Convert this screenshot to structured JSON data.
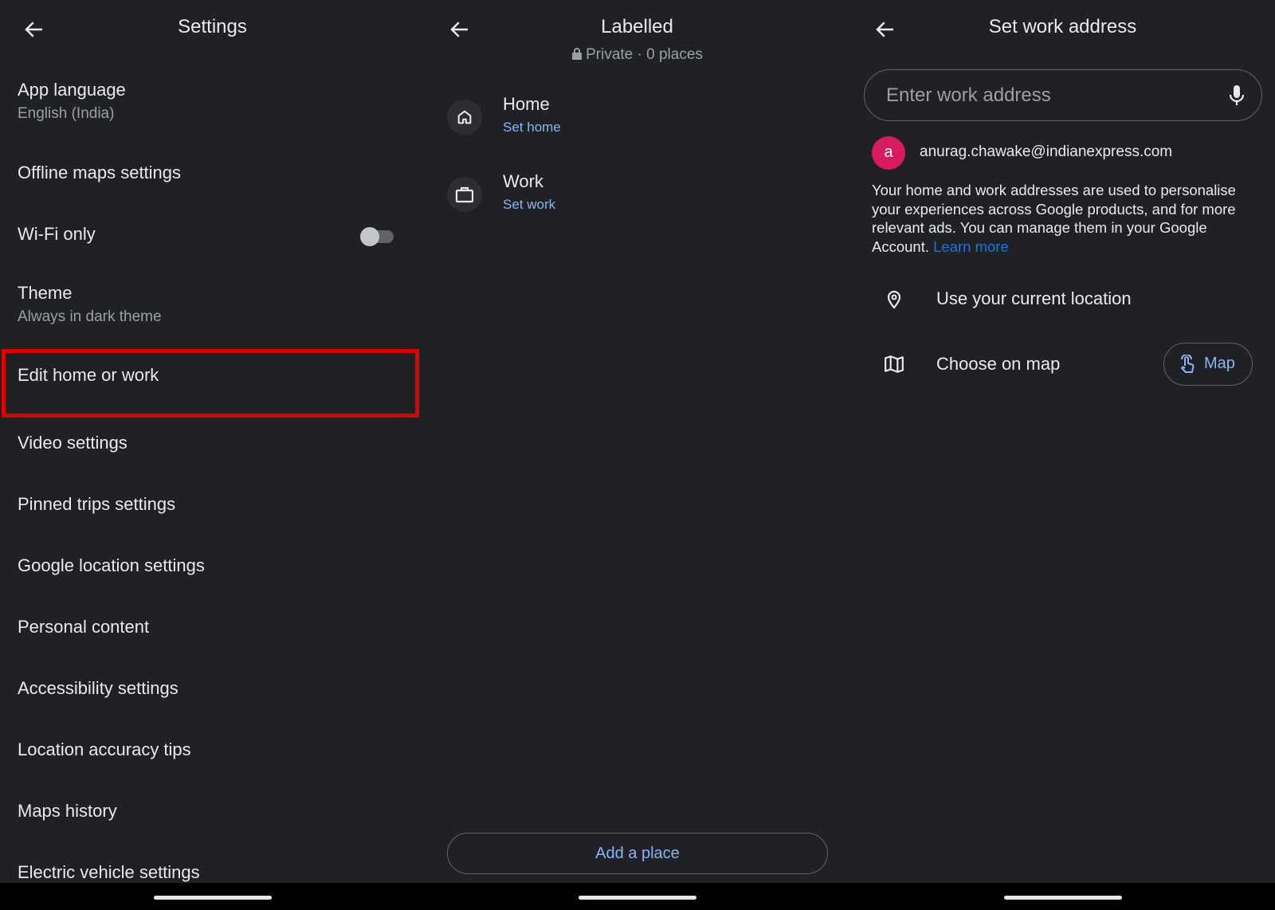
{
  "settings": {
    "title": "Settings",
    "items": [
      {
        "label": "App language",
        "sub": "English (India)"
      },
      {
        "label": "Offline maps settings"
      },
      {
        "label": "Wi-Fi only",
        "toggle": false
      },
      {
        "label": "Theme",
        "sub": "Always in dark theme"
      },
      {
        "label": "Edit home or work",
        "highlighted": true
      },
      {
        "label": "Video settings"
      },
      {
        "label": "Pinned trips settings"
      },
      {
        "label": "Google location settings"
      },
      {
        "label": "Personal content"
      },
      {
        "label": "Accessibility settings"
      },
      {
        "label": "Location accuracy tips"
      },
      {
        "label": "Maps history"
      },
      {
        "label": "Electric vehicle settings"
      }
    ],
    "highlight_color": "#e00000"
  },
  "labelled": {
    "title": "Labelled",
    "subtitle": "Private · 0 places",
    "places": [
      {
        "name": "Home",
        "action": "Set home",
        "icon": "home-icon"
      },
      {
        "name": "Work",
        "action": "Set work",
        "icon": "briefcase-icon"
      }
    ],
    "add_button": "Add a place"
  },
  "work_address": {
    "title": "Set work address",
    "search_placeholder": "Enter work address",
    "search_value": "",
    "avatar_letter": "a",
    "avatar_color": "#d81b60",
    "email": "anurag.chawake@indianexpress.com",
    "description": "Your home and work addresses are used to personalise your experiences across Google products, and for more relevant ads. You can manage them in your Google Account.",
    "learn_more": "Learn more",
    "options": [
      {
        "label": "Use your current location",
        "icon": "location-pin-icon"
      },
      {
        "label": "Choose on map",
        "icon": "map-icon"
      }
    ],
    "map_button": "Map"
  },
  "colors": {
    "background": "#202124",
    "text": "#e8eaed",
    "secondary_text": "#9aa0a6",
    "accent": "#8ab4f8",
    "link": "#1a73e8"
  }
}
